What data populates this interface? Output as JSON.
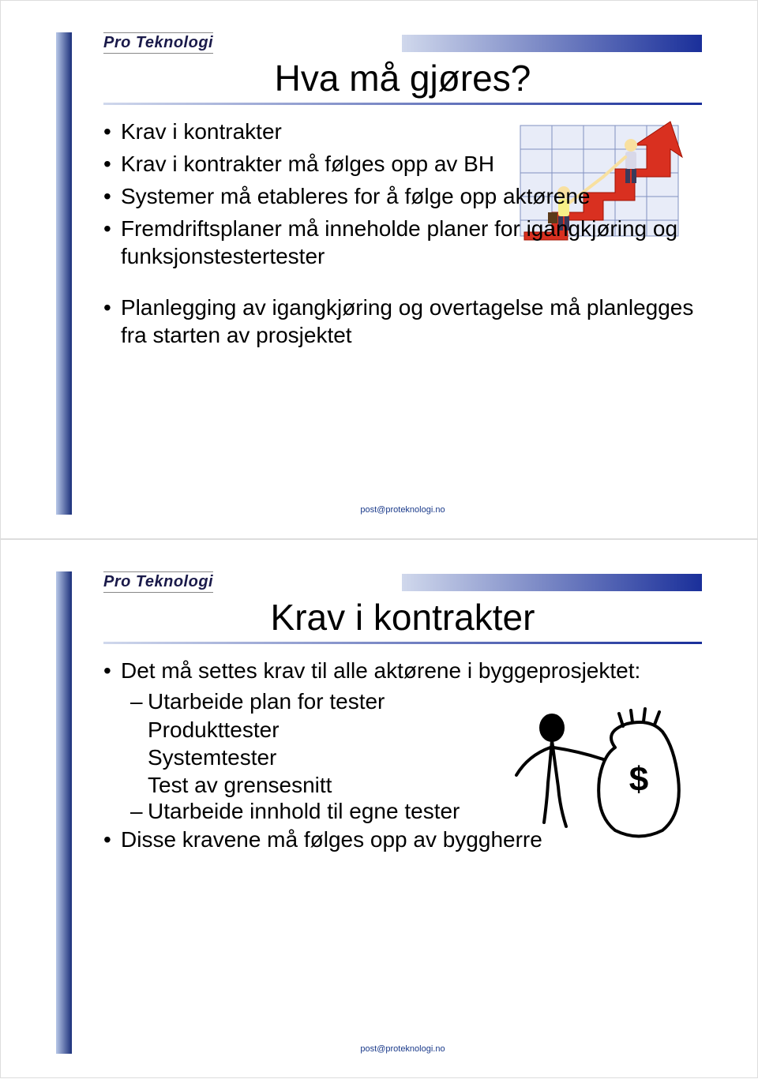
{
  "logo_text": "Pro Teknologi",
  "footer_email": "post@proteknologi.no",
  "slide1": {
    "title": "Hva må gjøres?",
    "bullets": [
      "Krav i kontrakter",
      "Krav i kontrakter må følges opp av BH",
      "Systemer må etableres for å følge opp aktørene",
      "Fremdriftsplaner må inneholde planer for igangkjøring og funksjonstestertester"
    ],
    "bullets2": [
      "Planlegging av igangkjøring og overtagelse må planlegges fra starten av prosjektet"
    ],
    "image_desc": "growth-arrow-people-icon"
  },
  "slide2": {
    "title": "Krav i kontrakter",
    "bullet1": "Det må settes krav til alle aktørene i byggeprosjektet:",
    "sub1": "Utarbeide plan for tester",
    "sub1_lines": [
      "Produkttester",
      "Systemtester",
      "Test av grensesnitt"
    ],
    "sub2": "Utarbeide innhold til egne tester",
    "bullet2": "Disse kravene må følges opp av byggherre",
    "image_desc": "person-money-bag-icon"
  }
}
